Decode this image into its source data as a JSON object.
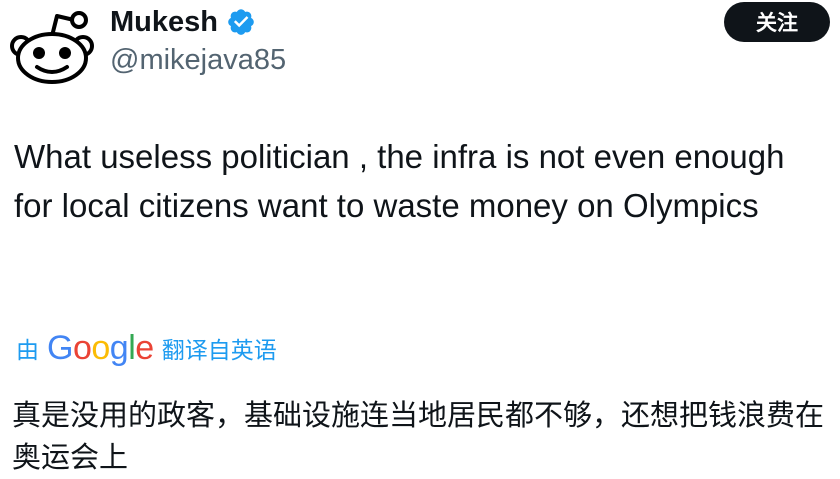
{
  "author": {
    "display_name": "Mukesh",
    "handle": "@mikejava85",
    "verified": true,
    "avatar_icon": "reddit-snoo-icon",
    "verified_icon": "verified-badge-icon",
    "verified_color": "#1d9bf0"
  },
  "follow_button": {
    "label": "关注",
    "background": "#0f1419",
    "text_color": "#ffffff"
  },
  "tweet": {
    "text": "What useless politician , the infra is not even enough for local citizens want to waste money on Olympics"
  },
  "translation": {
    "prefix": "由",
    "provider": [
      "G",
      "o",
      "o",
      "g",
      "l",
      "e"
    ],
    "suffix": "翻译自英语",
    "link_color": "#1d9bf0",
    "translated_text": "真是没用的政客，基础设施连当地居民都不够，还想把钱浪费在奥运会上"
  }
}
